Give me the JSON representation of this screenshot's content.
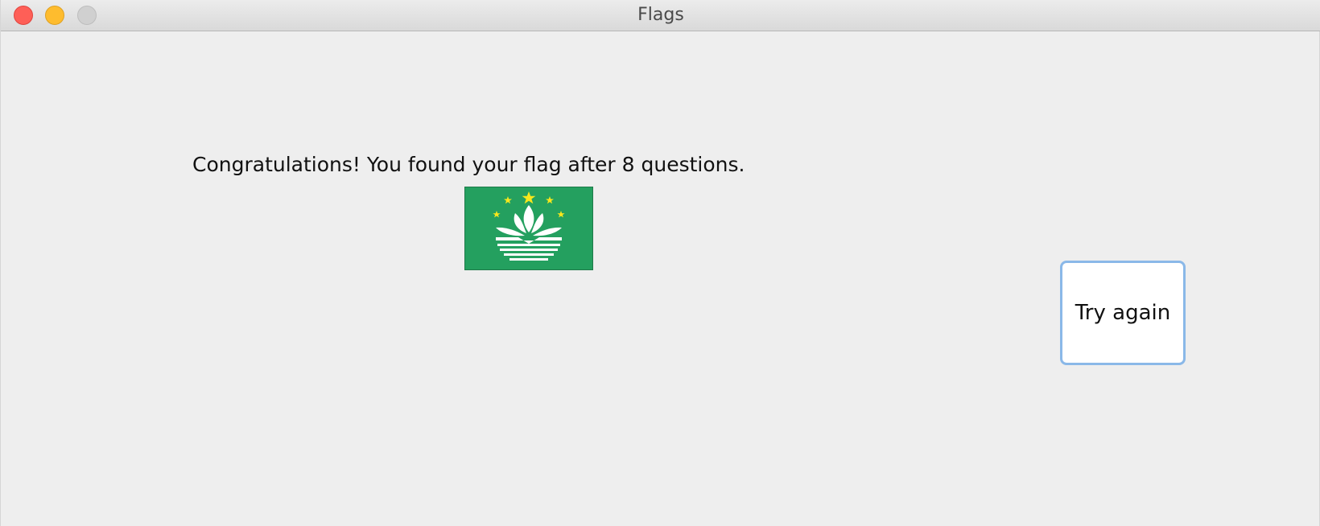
{
  "window": {
    "title": "Flags"
  },
  "main": {
    "message": "Congratulations! You found your flag after 8 questions.",
    "try_again_label": "Try again"
  },
  "flag": {
    "icon": "macau-flag-icon",
    "colors": {
      "field": "#24a05f",
      "lotus": "#ffffff",
      "stars": "#f8e71c"
    }
  }
}
